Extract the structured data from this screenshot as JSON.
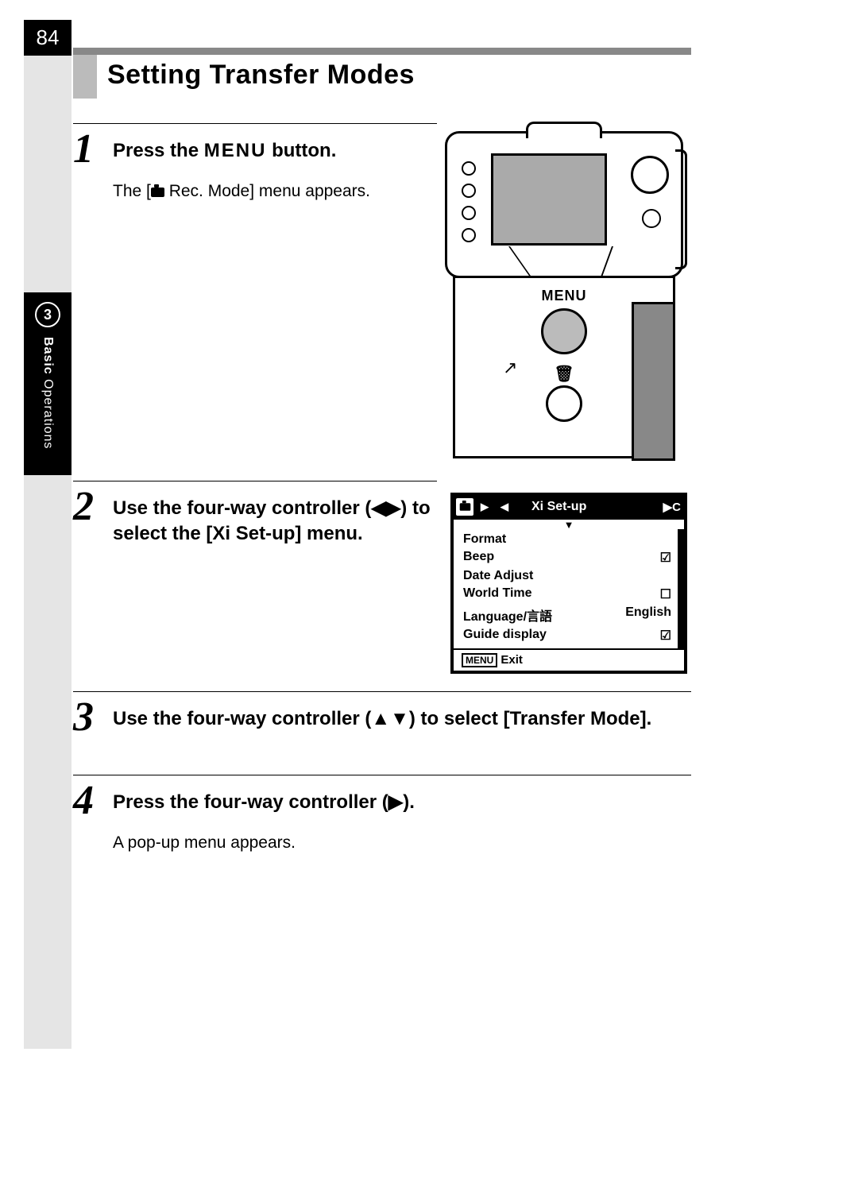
{
  "page_number": "84",
  "chapter": {
    "number": "3",
    "label_bold": "Basic",
    "label_rest": " Operations"
  },
  "title": "Setting Transfer Modes",
  "steps": {
    "s1": {
      "num": "1",
      "head_pre": "Press the ",
      "head_menu": "MENU",
      "head_post": " button.",
      "body_pre": "The [",
      "body_post": " Rec. Mode] menu appears."
    },
    "s2": {
      "num": "2",
      "head": "Use the four-way controller (◀▶) to select the [Xi Set-up] menu."
    },
    "s3": {
      "num": "3",
      "head": "Use the four-way controller (▲▼) to select [Transfer Mode]."
    },
    "s4": {
      "num": "4",
      "head": "Press the four-way controller (▶).",
      "body": "A pop-up menu appears."
    }
  },
  "camera_fig": {
    "menu_label": "MENU"
  },
  "lcd": {
    "tabs_left_arrow": "◀",
    "title": "Xi Set-up",
    "right": "▶C",
    "rows": [
      {
        "label": "Format",
        "value": ""
      },
      {
        "label": "Beep",
        "value": "☑"
      },
      {
        "label": "Date Adjust",
        "value": ""
      },
      {
        "label": "World Time",
        "value": "☐"
      },
      {
        "label": "Language/言語",
        "value": "English"
      },
      {
        "label": "Guide display",
        "value": "☑"
      }
    ],
    "footer_menu": "MENU",
    "footer_exit": "Exit"
  }
}
